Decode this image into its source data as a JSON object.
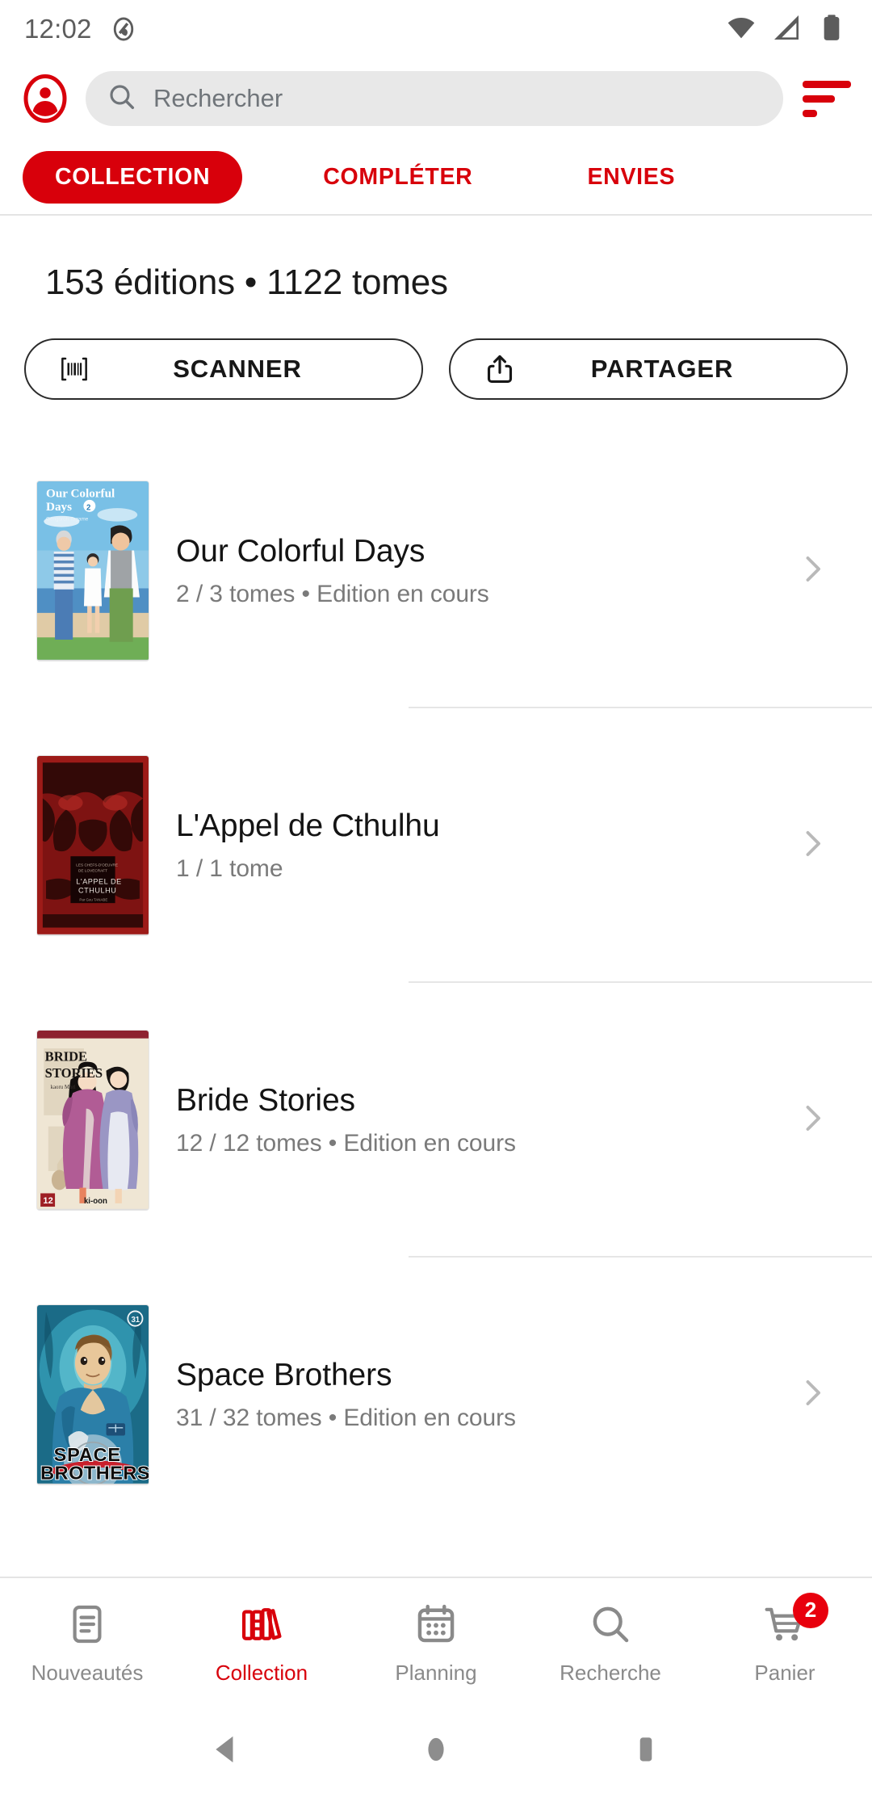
{
  "statusbar": {
    "time": "12:02",
    "icons": [
      "screenshot-capture-icon",
      "wifi-icon",
      "cellular-signal-icon",
      "battery-icon"
    ]
  },
  "header": {
    "avatar_icon": "account-avatar-icon",
    "search": {
      "placeholder": "Rechercher",
      "icon": "search-icon"
    },
    "filter_icon": "filter-sort-icon",
    "accent_color": "#d8000b"
  },
  "tabs": [
    {
      "label": "COLLECTION",
      "active": true
    },
    {
      "label": "COMPLÉTER",
      "active": false
    },
    {
      "label": "ENVIES",
      "active": false
    }
  ],
  "main": {
    "count_title": "153 éditions • 1122 tomes",
    "editions_count": 153,
    "volumes_count": 1122,
    "actions": [
      {
        "label": "SCANNER",
        "icon": "barcode-scanner-icon"
      },
      {
        "label": "PARTAGER",
        "icon": "share-icon"
      }
    ],
    "series": [
      {
        "title": "Our Colorful Days",
        "subtitle": "2 / 3 tomes • Edition en cours",
        "owned": 2,
        "total": 3,
        "status": "Edition en cours",
        "cover": "our-colorful-days-cover"
      },
      {
        "title": "L'Appel de Cthulhu",
        "subtitle": "1 / 1 tome",
        "owned": 1,
        "total": 1,
        "status": "",
        "cover": "appel-de-cthulhu-cover"
      },
      {
        "title": "Bride Stories",
        "subtitle": "12 / 12 tomes • Edition en cours",
        "owned": 12,
        "total": 12,
        "status": "Edition en cours",
        "cover": "bride-stories-cover"
      },
      {
        "title": "Space Brothers",
        "subtitle": "31 / 32 tomes • Edition en cours",
        "owned": 31,
        "total": 32,
        "status": "Edition en cours",
        "cover": "space-brothers-cover"
      }
    ]
  },
  "bottomnav": [
    {
      "label": "Nouveautés",
      "icon": "news-document-icon",
      "active": false
    },
    {
      "label": "Collection",
      "icon": "books-shelf-icon",
      "active": true
    },
    {
      "label": "Planning",
      "icon": "calendar-icon",
      "active": false
    },
    {
      "label": "Recherche",
      "icon": "search-icon",
      "active": false
    },
    {
      "label": "Panier",
      "icon": "shopping-cart-icon",
      "active": false,
      "badge": "2"
    }
  ],
  "androidnav": [
    {
      "icon": "back-triangle-icon"
    },
    {
      "icon": "home-circle-icon"
    },
    {
      "icon": "recents-square-icon"
    }
  ]
}
